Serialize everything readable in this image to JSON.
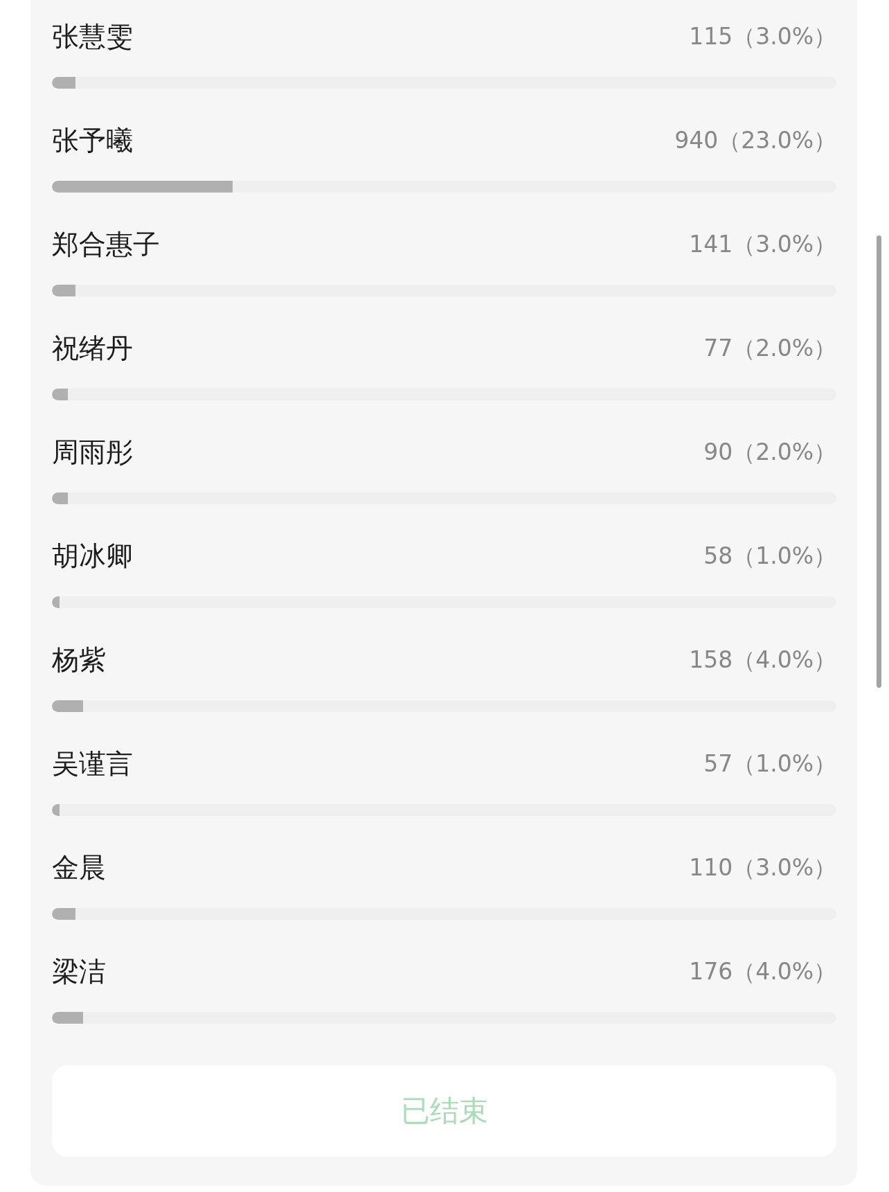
{
  "options": [
    {
      "name": "张慧雯",
      "count": "115（3.0%）",
      "level": 0.03
    },
    {
      "name": "张予曦",
      "count": "940（23.0%）",
      "level": 0.23
    },
    {
      "name": "郑合惠子",
      "count": "141（3.0%）",
      "level": 0.03
    },
    {
      "name": "祝绪丹",
      "count": "77（2.0%）",
      "level": 0.02
    },
    {
      "name": "周雨彤",
      "count": "90（2.0%）",
      "level": 0.02
    },
    {
      "name": "胡冰卿",
      "count": "58（1.0%）",
      "level": 0.01
    },
    {
      "name": "杨紫",
      "count": "158（4.0%）",
      "level": 0.04
    },
    {
      "name": "吴谨言",
      "count": "57（1.0%）",
      "level": 0.01
    },
    {
      "name": "金晨",
      "count": "110（3.0%）",
      "level": 0.03
    },
    {
      "name": "梁洁",
      "count": "176（4.0%）",
      "level": 0.04
    }
  ],
  "button": {
    "label": "已结束",
    "disabled": true
  }
}
